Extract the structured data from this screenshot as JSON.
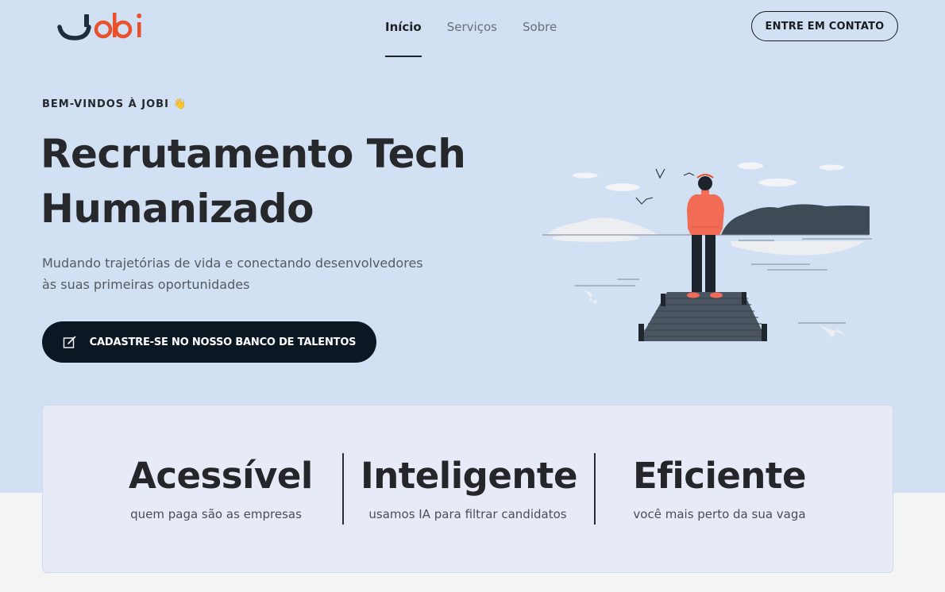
{
  "brand": {
    "logo_text": "Jobi"
  },
  "nav": {
    "items": [
      {
        "label": "Início",
        "active": true
      },
      {
        "label": "Serviços",
        "active": false
      },
      {
        "label": "Sobre",
        "active": false
      }
    ]
  },
  "header": {
    "contact_button": "ENTRE EM CONTATO"
  },
  "hero": {
    "eyebrow": "BEM-VINDOS À JOBI 👋",
    "title_line1": "Recrutamento Tech",
    "title_line2": "Humanizado",
    "subtitle_line1": "Mudando trajetórias de vida e conectando desenvolvedores",
    "subtitle_line2": "às suas primeiras oportunidades",
    "cta_label": "CADASTRE-SE NO NOSSO BANCO DE TALENTOS",
    "cta_icon": "edit-icon"
  },
  "features": [
    {
      "title": "Acessível",
      "caption": "quem paga são as empresas"
    },
    {
      "title": "Inteligente",
      "caption": "usamos IA para filtrar candidatos"
    },
    {
      "title": "Eficiente",
      "caption": "você mais perto da sua vaga"
    }
  ],
  "colors": {
    "hero_bg": "#d1e0f3",
    "dark": "#0b1823",
    "logo_dark": "#1c2d3e",
    "logo_accent": "#e8512a",
    "person_accent": "#f26b55"
  }
}
